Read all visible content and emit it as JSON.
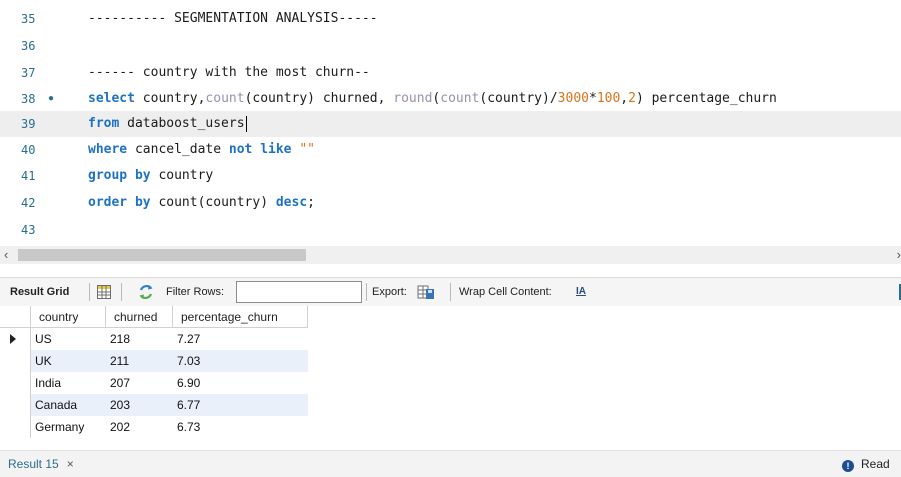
{
  "editor": {
    "lines": [
      {
        "num": "35",
        "segments": [
          {
            "t": "---------- SEGMENTATION ANALYSIS-----",
            "c": "cmt"
          }
        ]
      },
      {
        "num": "36",
        "segments": []
      },
      {
        "num": "37",
        "segments": [
          {
            "t": "------ country with the most churn--",
            "c": "cmt"
          }
        ]
      },
      {
        "num": "38",
        "bullet": "●",
        "segments": [
          {
            "t": "select",
            "c": "kw"
          },
          {
            "t": " country,",
            "c": ""
          },
          {
            "t": "count",
            "c": "fn"
          },
          {
            "t": "(country) churned, ",
            "c": ""
          },
          {
            "t": "round",
            "c": "fn"
          },
          {
            "t": "(",
            "c": ""
          },
          {
            "t": "count",
            "c": "fn"
          },
          {
            "t": "(country)/",
            "c": ""
          },
          {
            "t": "3000",
            "c": "num"
          },
          {
            "t": "*",
            "c": ""
          },
          {
            "t": "100",
            "c": "num"
          },
          {
            "t": ",",
            "c": ""
          },
          {
            "t": "2",
            "c": "num"
          },
          {
            "t": ") percentage_churn",
            "c": ""
          }
        ]
      },
      {
        "num": "39",
        "active": true,
        "cursor": true,
        "segments": [
          {
            "t": "from",
            "c": "kw"
          },
          {
            "t": " databoost_users",
            "c": ""
          }
        ]
      },
      {
        "num": "40",
        "segments": [
          {
            "t": "where",
            "c": "kw"
          },
          {
            "t": " cancel_date ",
            "c": ""
          },
          {
            "t": "not like",
            "c": "kw"
          },
          {
            "t": " ",
            "c": ""
          },
          {
            "t": "\"\"",
            "c": "str"
          }
        ]
      },
      {
        "num": "41",
        "segments": [
          {
            "t": "group by",
            "c": "kw"
          },
          {
            "t": " country",
            "c": ""
          }
        ]
      },
      {
        "num": "42",
        "segments": [
          {
            "t": "order by",
            "c": "kw"
          },
          {
            "t": " count(country) ",
            "c": ""
          },
          {
            "t": "desc",
            "c": "kw"
          },
          {
            "t": ";",
            "c": ""
          }
        ]
      },
      {
        "num": "43",
        "segments": []
      }
    ]
  },
  "toolbar": {
    "result_grid": "Result Grid",
    "filter_rows": "Filter Rows:",
    "filter_value": "",
    "export": "Export:",
    "wrap_cell": "Wrap Cell Content:",
    "wrap_icon": "IA"
  },
  "grid": {
    "columns": [
      "country",
      "churned",
      "percentage_churn"
    ],
    "rows": [
      [
        "US",
        "218",
        "7.27"
      ],
      [
        "UK",
        "211",
        "7.03"
      ],
      [
        "India",
        "207",
        "6.90"
      ],
      [
        "Canada",
        "203",
        "6.77"
      ],
      [
        "Germany",
        "202",
        "6.73"
      ]
    ]
  },
  "status": {
    "tab_label": "Result 15",
    "tab_close": "×",
    "right_text": "Read"
  },
  "colors": {
    "keyword": "#1e72c4",
    "function": "#9a8fb0",
    "number": "#d9731a",
    "line_number": "#2a6e8f",
    "alt_row": "#e9f0fa"
  }
}
